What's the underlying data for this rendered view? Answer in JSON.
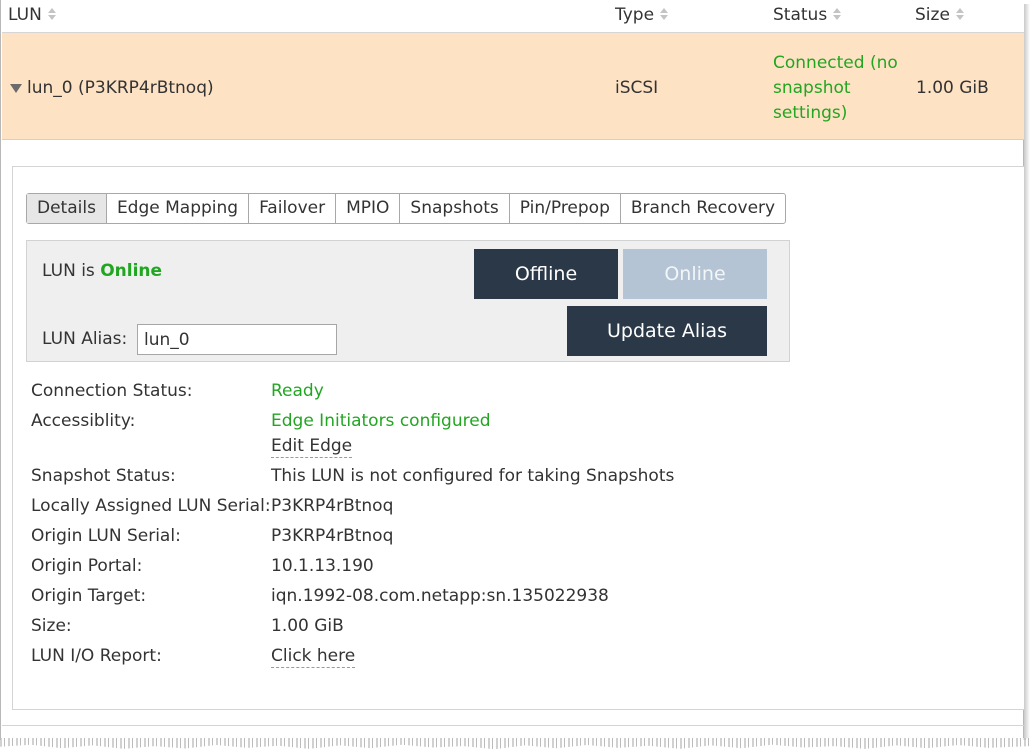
{
  "table": {
    "columns": [
      "LUN",
      "Type",
      "Status",
      "Size"
    ],
    "row": {
      "lun": "lun_0 (P3KRP4rBtnoq)",
      "type": "iSCSI",
      "status_line1": "Connected (no",
      "status_line2": "snapshot",
      "status_line3": "settings)",
      "size": "1.00 GiB"
    }
  },
  "tabs": [
    "Details",
    "Edge Mapping",
    "Failover",
    "MPIO",
    "Snapshots",
    "Pin/Prepop",
    "Branch Recovery"
  ],
  "active_tab": "Details",
  "state_box": {
    "lun_is_prefix": "LUN is",
    "state": "Online",
    "offline_button": "Offline",
    "online_button": "Online",
    "alias_label": "LUN Alias:",
    "alias_value": "lun_0",
    "update_alias_button": "Update Alias"
  },
  "properties": {
    "connection_status_label": "Connection Status:",
    "connection_status_value": "Ready",
    "accessibility_label": "Accessiblity:",
    "accessibility_value": "Edge Initiators configured",
    "edit_edge_link": "Edit Edge",
    "snapshot_status_label": "Snapshot Status:",
    "snapshot_status_value": "This LUN is not configured for taking Snapshots",
    "local_serial_label": "Locally Assigned LUN Serial:",
    "local_serial_value": "P3KRP4rBtnoq",
    "origin_serial_label": "Origin LUN Serial:",
    "origin_serial_value": "P3KRP4rBtnoq",
    "origin_portal_label": "Origin Portal:",
    "origin_portal_value": "10.1.13.190",
    "origin_target_label": "Origin Target:",
    "origin_target_value": "iqn.1992-08.com.netapp:sn.135022938",
    "size_label": "Size:",
    "size_value": "1.00 GiB",
    "io_report_label": "LUN I/O Report:",
    "io_report_link": "Click here"
  },
  "colors": {
    "selected_row": "#fde2c4",
    "status_green": "#22a622",
    "dark_button": "#2b3848",
    "disabled_button": "#b4c4d4"
  }
}
